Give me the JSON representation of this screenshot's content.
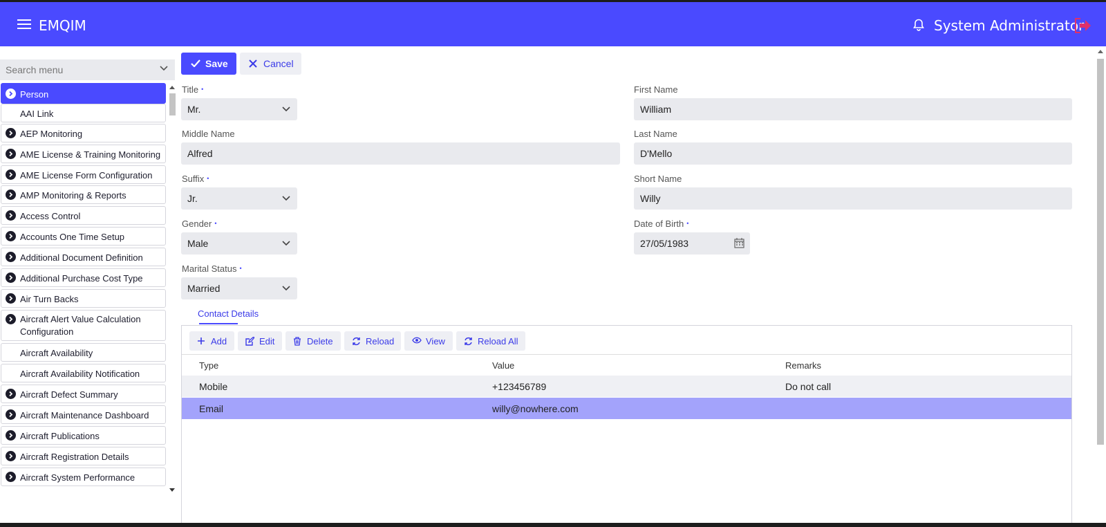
{
  "header": {
    "app_title": "EMQIM",
    "user_name": "System Administrator"
  },
  "sidebar": {
    "search_placeholder": "Search menu",
    "items": [
      {
        "label": "Person",
        "icon": "chevron-right-circle-icon",
        "active": true
      },
      {
        "label": "AAI Link",
        "icon": ""
      },
      {
        "label": "AEP Monitoring",
        "icon": "chevron-right-circle-icon"
      },
      {
        "label": "AME License & Training Monitoring",
        "icon": "chevron-right-circle-icon"
      },
      {
        "label": "AME License Form Configuration",
        "icon": "chevron-right-circle-icon"
      },
      {
        "label": "AMP Monitoring & Reports",
        "icon": "chevron-right-circle-icon"
      },
      {
        "label": "Access Control",
        "icon": "chevron-right-circle-icon"
      },
      {
        "label": "Accounts One Time Setup",
        "icon": "chevron-right-circle-icon"
      },
      {
        "label": "Additional Document Definition",
        "icon": "chevron-right-circle-icon"
      },
      {
        "label": "Additional Purchase Cost Type",
        "icon": "chevron-right-circle-icon"
      },
      {
        "label": "Air Turn Backs",
        "icon": "chevron-right-circle-icon"
      },
      {
        "label": "Aircraft Alert Value Calculation Configuration",
        "icon": "chevron-right-circle-icon"
      },
      {
        "label": "Aircraft Availability",
        "icon": ""
      },
      {
        "label": "Aircraft Availability Notification",
        "icon": ""
      },
      {
        "label": "Aircraft Defect Summary",
        "icon": "chevron-right-circle-icon"
      },
      {
        "label": "Aircraft Maintenance Dashboard",
        "icon": "chevron-right-circle-icon"
      },
      {
        "label": "Aircraft Publications",
        "icon": "chevron-right-circle-icon"
      },
      {
        "label": "Aircraft Registration Details",
        "icon": "chevron-right-circle-icon"
      },
      {
        "label": "Aircraft System Performance",
        "icon": "chevron-right-circle-icon"
      }
    ]
  },
  "toolbar": {
    "save_label": "Save",
    "cancel_label": "Cancel"
  },
  "form": {
    "title": {
      "label": "Title",
      "value": "Mr."
    },
    "first_name": {
      "label": "First Name",
      "value": "William"
    },
    "middle_name": {
      "label": "Middle Name",
      "value": "Alfred"
    },
    "last_name": {
      "label": "Last Name",
      "value": "D'Mello"
    },
    "suffix": {
      "label": "Suffix",
      "value": "Jr."
    },
    "short_name": {
      "label": "Short Name",
      "value": "Willy"
    },
    "gender": {
      "label": "Gender",
      "value": "Male"
    },
    "date_of_birth": {
      "label": "Date of Birth",
      "value": "27/05/1983"
    },
    "marital_status": {
      "label": "Marital Status",
      "value": "Married"
    },
    "required_marker": "•"
  },
  "tabs": {
    "contact_details": "Contact Details"
  },
  "grid": {
    "buttons": {
      "add": "Add",
      "edit": "Edit",
      "delete": "Delete",
      "reload": "Reload",
      "view": "View",
      "reload_all": "Reload All"
    },
    "columns": {
      "type": "Type",
      "value": "Value",
      "remarks": "Remarks"
    },
    "rows": [
      {
        "type": "Mobile",
        "value": "+123456789",
        "remarks": "Do not call"
      },
      {
        "type": "Email",
        "value": "willy@nowhere.com",
        "remarks": ""
      }
    ]
  },
  "colors": {
    "brand": "#4a4aff",
    "selected_row": "#a3a3fb",
    "field_bg": "#e9eaee"
  }
}
